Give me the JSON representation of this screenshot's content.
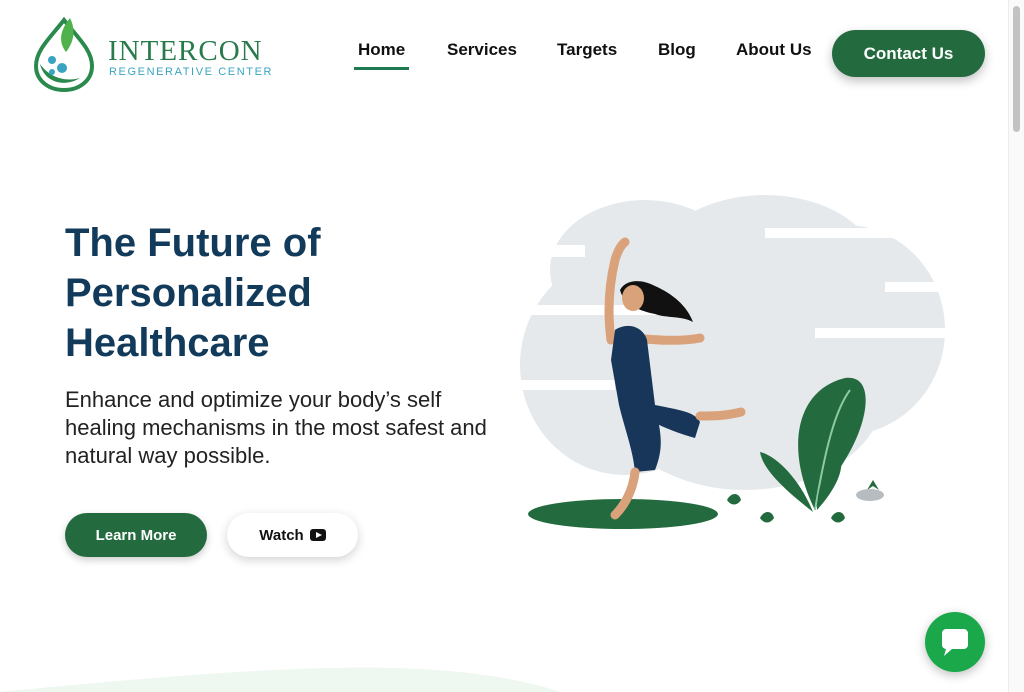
{
  "brand": {
    "name": "INTERCON",
    "tagline": "REGENERATIVE CENTER"
  },
  "nav": {
    "items": [
      {
        "label": "Home",
        "active": true
      },
      {
        "label": "Services",
        "active": false
      },
      {
        "label": "Targets",
        "active": false
      },
      {
        "label": "Blog",
        "active": false
      },
      {
        "label": "About Us",
        "active": false
      }
    ],
    "contact_label": "Contact Us"
  },
  "hero": {
    "title_line1": "The Future of",
    "title_line2": "Personalized",
    "title_line3": "Healthcare",
    "subtitle": "Enhance and optimize your body’s self healing mechanisms in the most safest and natural way possible.",
    "learn_more_label": "Learn More",
    "watch_label": "Watch"
  },
  "icons": {
    "logo": "drop-leaf-logo-icon",
    "watch": "youtube-play-icon",
    "chat": "chat-bubble-icon"
  },
  "colors": {
    "primary_green": "#236b3f",
    "navy": "#123a5a",
    "chat_green": "#1aa84b",
    "logo_teal": "#3aa3c2"
  }
}
